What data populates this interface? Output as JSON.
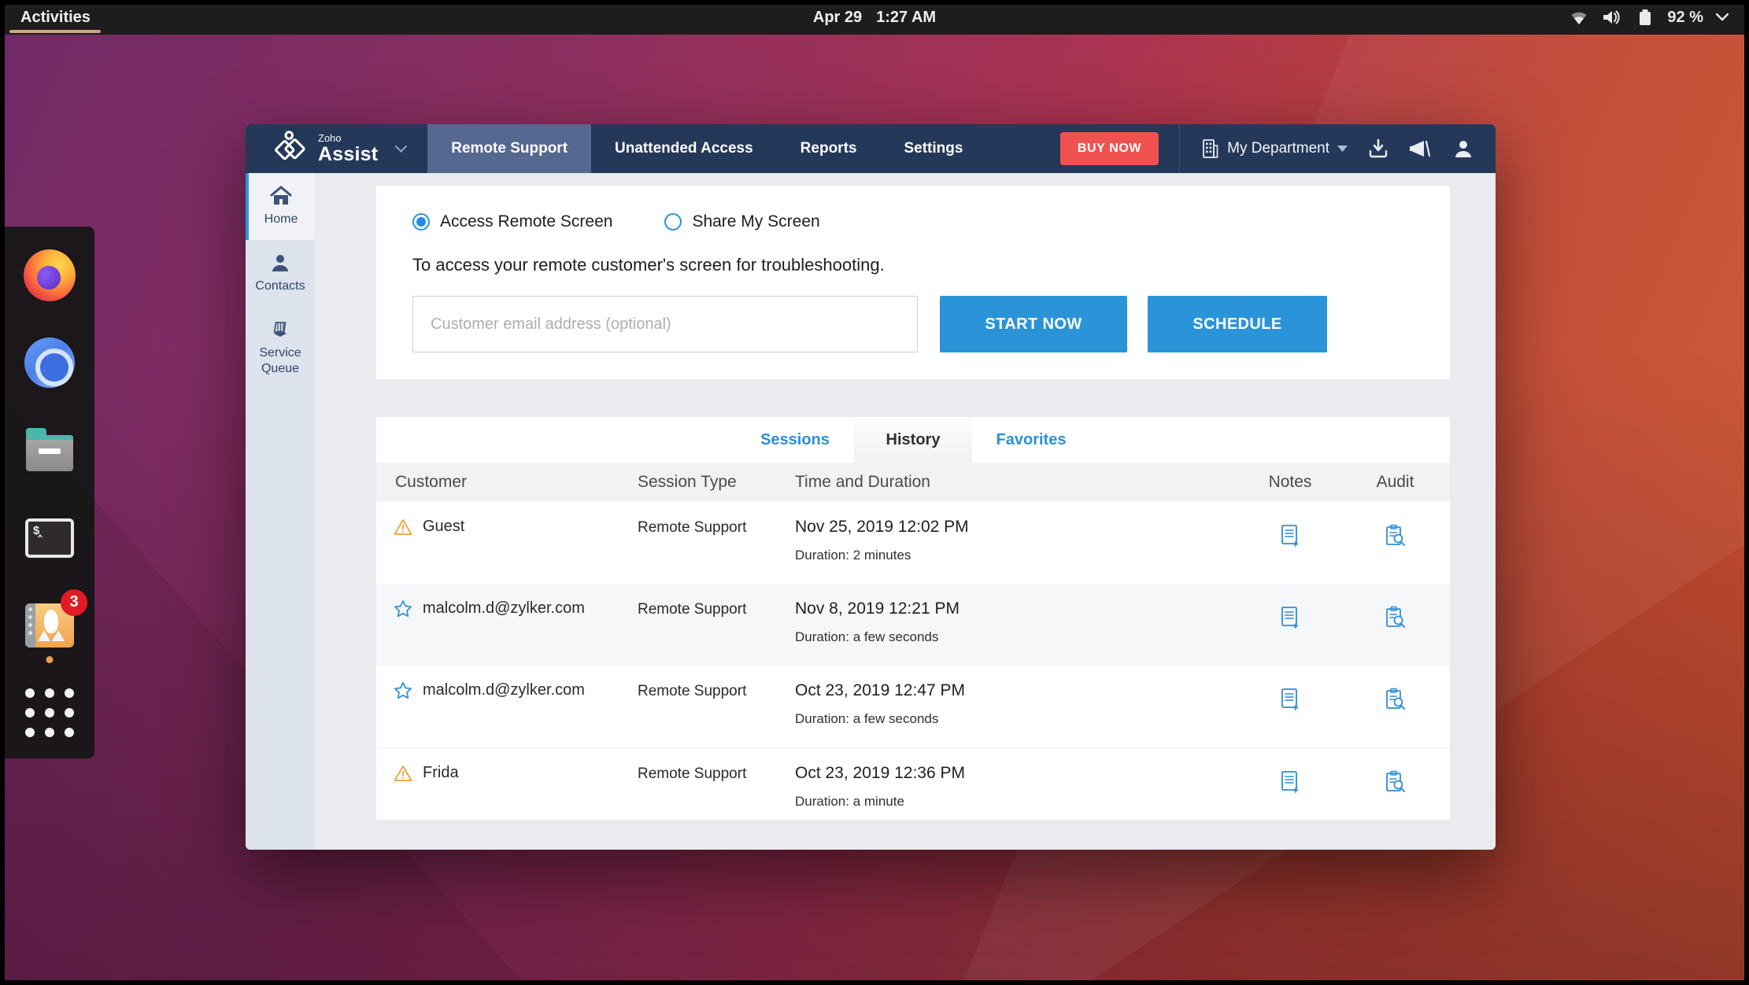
{
  "colors": {
    "accent_blue": "#2b93d8",
    "navy": "#24385a",
    "buy_red": "#f0534f",
    "warn_orange": "#f0a136",
    "link_blue": "#2b8fd9"
  },
  "topbar": {
    "activities": "Activities",
    "date": "Apr 29",
    "time": "1:27 AM",
    "battery": "92 %"
  },
  "dock": {
    "items": [
      "firefox",
      "chromium",
      "files",
      "terminal",
      "software-updater",
      "app-grid"
    ],
    "software_badge": "3"
  },
  "app": {
    "brand_small": "Zoho",
    "brand_large": "Assist",
    "nav_tabs": [
      {
        "label": "Remote Support",
        "active": true
      },
      {
        "label": "Unattended Access",
        "active": false
      },
      {
        "label": "Reports",
        "active": false
      },
      {
        "label": "Settings",
        "active": false
      }
    ],
    "buy_now": "BUY NOW",
    "department": "My Department",
    "sidebar": [
      {
        "label": "Home",
        "active": true
      },
      {
        "label": "Contacts",
        "active": false
      },
      {
        "label": "Service Queue",
        "active": false
      }
    ],
    "form": {
      "radio_access": "Access Remote Screen",
      "radio_share": "Share My Screen",
      "description": "To access your remote customer's screen for troubleshooting.",
      "email_placeholder": "Customer email address (optional)",
      "start_button": "START NOW",
      "schedule_button": "SCHEDULE"
    },
    "history_tabs": [
      {
        "label": "Sessions",
        "active": false
      },
      {
        "label": "History",
        "active": true
      },
      {
        "label": "Favorites",
        "active": false
      }
    ],
    "table": {
      "headers": {
        "customer": "Customer",
        "type": "Session Type",
        "time": "Time and Duration",
        "notes": "Notes",
        "audit": "Audit"
      },
      "rows": [
        {
          "icon": "warning-icon",
          "customer": "Guest",
          "type": "Remote Support",
          "time": "Nov 25, 2019 12:02 PM",
          "duration": "Duration: 2 minutes"
        },
        {
          "icon": "star-icon",
          "customer": "malcolm.d@zylker.com",
          "type": "Remote Support",
          "time": "Nov 8, 2019 12:21 PM",
          "duration": "Duration: a few seconds"
        },
        {
          "icon": "star-icon",
          "customer": "malcolm.d@zylker.com",
          "type": "Remote Support",
          "time": "Oct 23, 2019 12:47 PM",
          "duration": "Duration: a few seconds"
        },
        {
          "icon": "warning-icon",
          "customer": "Frida",
          "type": "Remote Support",
          "time": "Oct 23, 2019 12:36 PM",
          "duration": "Duration: a minute"
        }
      ]
    }
  }
}
